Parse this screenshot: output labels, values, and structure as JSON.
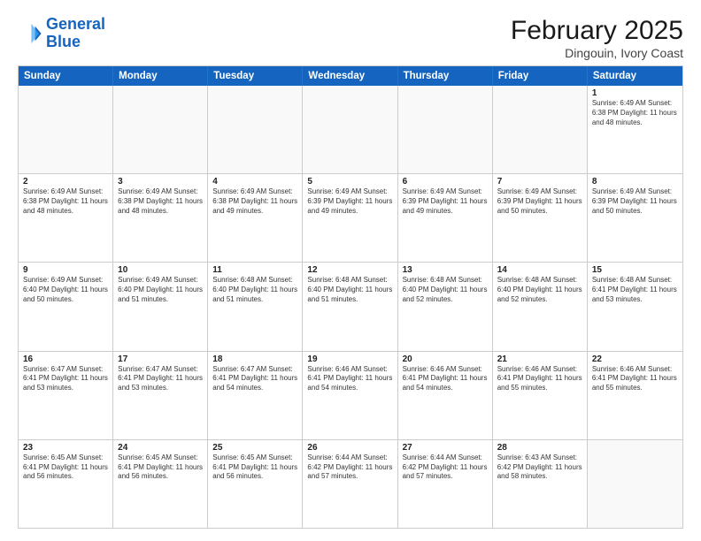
{
  "logo": {
    "line1": "General",
    "line2": "Blue"
  },
  "title": "February 2025",
  "subtitle": "Dingouin, Ivory Coast",
  "weekdays": [
    "Sunday",
    "Monday",
    "Tuesday",
    "Wednesday",
    "Thursday",
    "Friday",
    "Saturday"
  ],
  "weeks": [
    [
      {
        "day": "",
        "text": ""
      },
      {
        "day": "",
        "text": ""
      },
      {
        "day": "",
        "text": ""
      },
      {
        "day": "",
        "text": ""
      },
      {
        "day": "",
        "text": ""
      },
      {
        "day": "",
        "text": ""
      },
      {
        "day": "1",
        "text": "Sunrise: 6:49 AM\nSunset: 6:38 PM\nDaylight: 11 hours and 48 minutes."
      }
    ],
    [
      {
        "day": "2",
        "text": "Sunrise: 6:49 AM\nSunset: 6:38 PM\nDaylight: 11 hours and 48 minutes."
      },
      {
        "day": "3",
        "text": "Sunrise: 6:49 AM\nSunset: 6:38 PM\nDaylight: 11 hours and 48 minutes."
      },
      {
        "day": "4",
        "text": "Sunrise: 6:49 AM\nSunset: 6:38 PM\nDaylight: 11 hours and 49 minutes."
      },
      {
        "day": "5",
        "text": "Sunrise: 6:49 AM\nSunset: 6:39 PM\nDaylight: 11 hours and 49 minutes."
      },
      {
        "day": "6",
        "text": "Sunrise: 6:49 AM\nSunset: 6:39 PM\nDaylight: 11 hours and 49 minutes."
      },
      {
        "day": "7",
        "text": "Sunrise: 6:49 AM\nSunset: 6:39 PM\nDaylight: 11 hours and 50 minutes."
      },
      {
        "day": "8",
        "text": "Sunrise: 6:49 AM\nSunset: 6:39 PM\nDaylight: 11 hours and 50 minutes."
      }
    ],
    [
      {
        "day": "9",
        "text": "Sunrise: 6:49 AM\nSunset: 6:40 PM\nDaylight: 11 hours and 50 minutes."
      },
      {
        "day": "10",
        "text": "Sunrise: 6:49 AM\nSunset: 6:40 PM\nDaylight: 11 hours and 51 minutes."
      },
      {
        "day": "11",
        "text": "Sunrise: 6:48 AM\nSunset: 6:40 PM\nDaylight: 11 hours and 51 minutes."
      },
      {
        "day": "12",
        "text": "Sunrise: 6:48 AM\nSunset: 6:40 PM\nDaylight: 11 hours and 51 minutes."
      },
      {
        "day": "13",
        "text": "Sunrise: 6:48 AM\nSunset: 6:40 PM\nDaylight: 11 hours and 52 minutes."
      },
      {
        "day": "14",
        "text": "Sunrise: 6:48 AM\nSunset: 6:40 PM\nDaylight: 11 hours and 52 minutes."
      },
      {
        "day": "15",
        "text": "Sunrise: 6:48 AM\nSunset: 6:41 PM\nDaylight: 11 hours and 53 minutes."
      }
    ],
    [
      {
        "day": "16",
        "text": "Sunrise: 6:47 AM\nSunset: 6:41 PM\nDaylight: 11 hours and 53 minutes."
      },
      {
        "day": "17",
        "text": "Sunrise: 6:47 AM\nSunset: 6:41 PM\nDaylight: 11 hours and 53 minutes."
      },
      {
        "day": "18",
        "text": "Sunrise: 6:47 AM\nSunset: 6:41 PM\nDaylight: 11 hours and 54 minutes."
      },
      {
        "day": "19",
        "text": "Sunrise: 6:46 AM\nSunset: 6:41 PM\nDaylight: 11 hours and 54 minutes."
      },
      {
        "day": "20",
        "text": "Sunrise: 6:46 AM\nSunset: 6:41 PM\nDaylight: 11 hours and 54 minutes."
      },
      {
        "day": "21",
        "text": "Sunrise: 6:46 AM\nSunset: 6:41 PM\nDaylight: 11 hours and 55 minutes."
      },
      {
        "day": "22",
        "text": "Sunrise: 6:46 AM\nSunset: 6:41 PM\nDaylight: 11 hours and 55 minutes."
      }
    ],
    [
      {
        "day": "23",
        "text": "Sunrise: 6:45 AM\nSunset: 6:41 PM\nDaylight: 11 hours and 56 minutes."
      },
      {
        "day": "24",
        "text": "Sunrise: 6:45 AM\nSunset: 6:41 PM\nDaylight: 11 hours and 56 minutes."
      },
      {
        "day": "25",
        "text": "Sunrise: 6:45 AM\nSunset: 6:41 PM\nDaylight: 11 hours and 56 minutes."
      },
      {
        "day": "26",
        "text": "Sunrise: 6:44 AM\nSunset: 6:42 PM\nDaylight: 11 hours and 57 minutes."
      },
      {
        "day": "27",
        "text": "Sunrise: 6:44 AM\nSunset: 6:42 PM\nDaylight: 11 hours and 57 minutes."
      },
      {
        "day": "28",
        "text": "Sunrise: 6:43 AM\nSunset: 6:42 PM\nDaylight: 11 hours and 58 minutes."
      },
      {
        "day": "",
        "text": ""
      }
    ]
  ]
}
